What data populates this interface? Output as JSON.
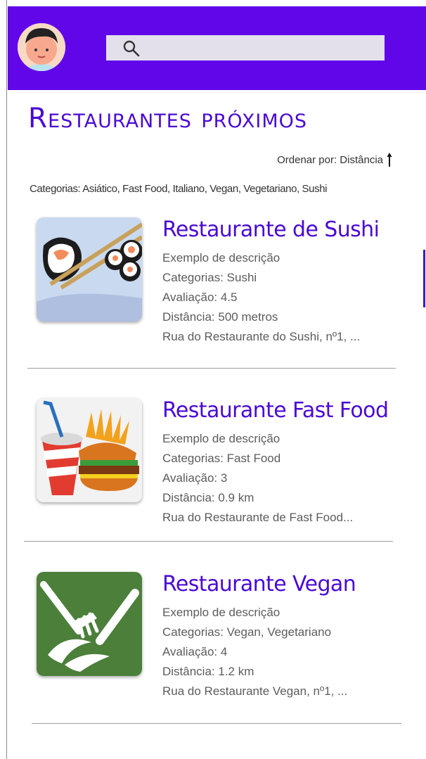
{
  "colors": {
    "accent": "#6206ea",
    "title": "#4a09d6",
    "search_bg": "#e3e0ec"
  },
  "header": {
    "avatar_icon": "user-avatar-icon",
    "search": {
      "icon": "search-icon",
      "placeholder": ""
    }
  },
  "page": {
    "title": "Restaurantes próximos",
    "sort_label": "Ordenar por: Distância",
    "sort_icon": "arrow-up-icon",
    "categories_label": "Categorias: Asiático, Fast Food, Italiano, Vegan, Vegetariano, Sushi"
  },
  "restaurants": [
    {
      "name": "Restaurante de Sushi",
      "description": "Exemplo de descrição",
      "categories": "Categorias: Sushi",
      "rating": "Avaliação: 4.5",
      "distance": "Distância: 500 metros",
      "address": "Rua do Restaurante do Sushi, nº1, ...",
      "image_icon": "sushi-image"
    },
    {
      "name": "Restaurante Fast Food",
      "description": "Exemplo de descrição",
      "categories": "Categorias: Fast Food",
      "rating": "Avaliação: 3",
      "distance": "Distância: 0.9 km",
      "address": "Rua do Restaurante de Fast Food...",
      "image_icon": "fast-food-image"
    },
    {
      "name": "Restaurante Vegan",
      "description": "Exemplo de descrição",
      "categories": "Categorias: Vegan, Vegetariano",
      "rating": "Avaliação: 4",
      "distance": "Distância: 1.2 km",
      "address": "Rua do Restaurante Vegan, nº1, ...",
      "image_icon": "vegan-image"
    }
  ]
}
